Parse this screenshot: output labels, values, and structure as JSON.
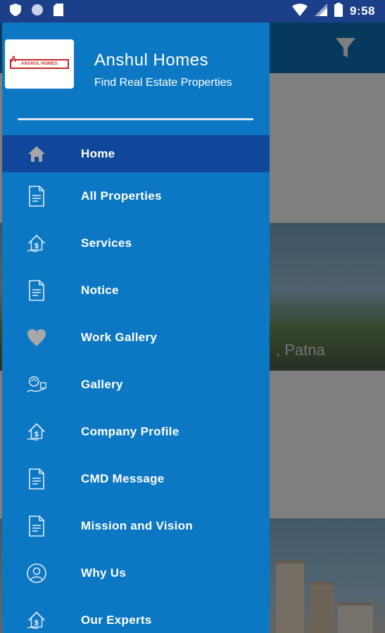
{
  "status_bar": {
    "time": "9:58",
    "left_icons": [
      "shield-icon",
      "circle-icon",
      "sim-card-icon"
    ],
    "right_icons": [
      "wifi-icon",
      "signal-icon",
      "battery-icon"
    ]
  },
  "background": {
    "card_caption": ", Patna"
  },
  "drawer": {
    "logo_text": "ANSHUL HOMES",
    "app_name": "Anshul Homes",
    "tagline": "Find Real Estate Properties",
    "items": [
      {
        "label": "Home",
        "icon": "home-icon",
        "active": true
      },
      {
        "label": "All Properties",
        "icon": "document-icon",
        "active": false
      },
      {
        "label": "Services",
        "icon": "house-money-icon",
        "active": false
      },
      {
        "label": "Notice",
        "icon": "document-icon",
        "active": false
      },
      {
        "label": "Work Gallery",
        "icon": "heart-icon",
        "active": false
      },
      {
        "label": "Gallery",
        "icon": "gallery-icon",
        "active": false
      },
      {
        "label": "Company Profile",
        "icon": "house-money-icon",
        "active": false
      },
      {
        "label": "CMD Message",
        "icon": "document-icon",
        "active": false
      },
      {
        "label": "Mission and Vision",
        "icon": "document-icon",
        "active": false
      },
      {
        "label": "Why Us",
        "icon": "user-circle-icon",
        "active": false
      },
      {
        "label": "Our Experts",
        "icon": "house-money-icon",
        "active": false
      }
    ]
  },
  "colors": {
    "status_bar": "#1c3f8a",
    "drawer": "#0c78c3",
    "active_item": "#10479a",
    "toolbar": "#0c72b8",
    "logo_red": "#c62828"
  }
}
